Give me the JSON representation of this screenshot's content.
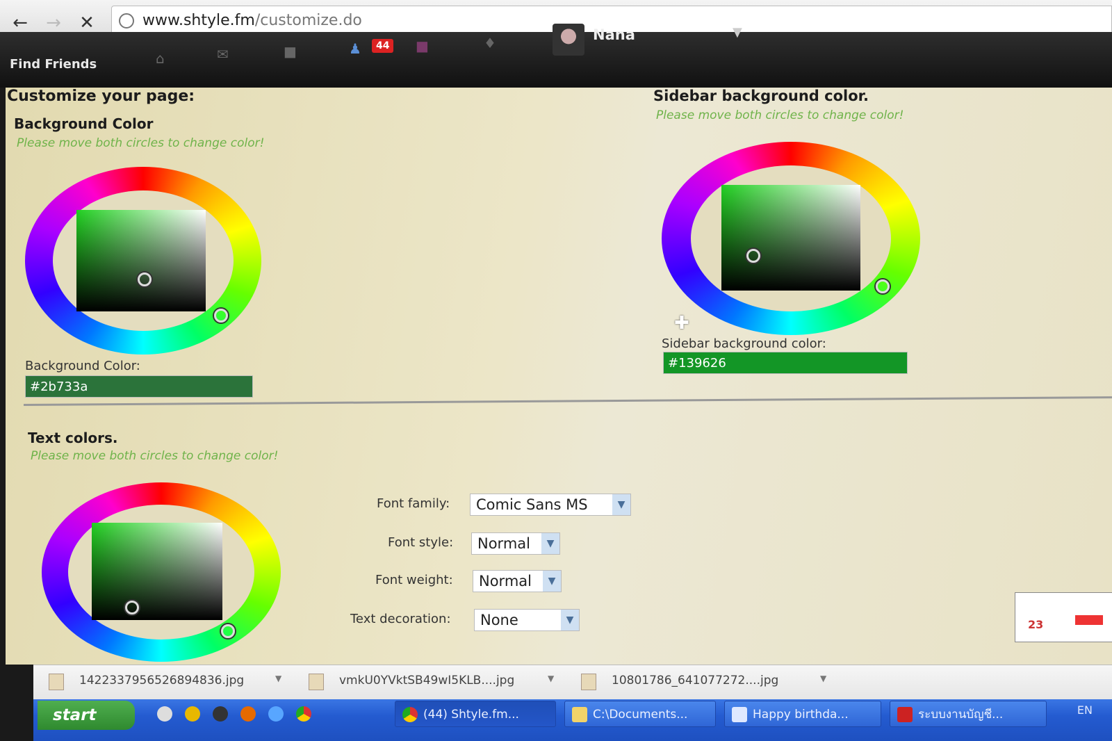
{
  "browser": {
    "url_host": "www.shtyle.fm",
    "url_path": "/customize.do"
  },
  "topbar": {
    "find_friends": "Find Friends",
    "notification_count": "44",
    "user_name": "Nana"
  },
  "page": {
    "title": "Customize your page:",
    "background": {
      "heading": "Background Color",
      "hint": "Please move both circles to change color!",
      "field_label": "Background Color:",
      "value": "#2b733a"
    },
    "sidebar": {
      "heading": "Sidebar background color.",
      "hint": "Please move both circles to change color!",
      "field_label": "Sidebar background color:",
      "value": "#139626"
    },
    "text_colors": {
      "heading": "Text colors.",
      "hint": "Please move both circles to change color!"
    },
    "font": {
      "family_label": "Font family:",
      "family_value": "Comic Sans MS",
      "style_label": "Font style:",
      "style_value": "Normal",
      "weight_label": "Font weight:",
      "weight_value": "Normal",
      "decoration_label": "Text decoration:",
      "decoration_value": "None"
    },
    "mini_widget_number": "23"
  },
  "downloads": [
    {
      "name": "1422337956526894836.jpg"
    },
    {
      "name": "vmkU0YVktSB49wI5KLB....jpg"
    },
    {
      "name": "10801786_641077272....jpg"
    }
  ],
  "taskbar": {
    "start": "start",
    "tasks": [
      {
        "label": "(44) Shtyle.fm..."
      },
      {
        "label": "C:\\Documents..."
      },
      {
        "label": "Happy birthda..."
      },
      {
        "label": "ระบบงานบัญชี..."
      }
    ],
    "lang": "EN"
  },
  "colors": {
    "background_swatch": "#2b733a",
    "sidebar_swatch": "#139626",
    "hint_green": "#6fb34a"
  },
  "icons": [
    "back-arrow-icon",
    "forward-arrow-icon",
    "stop-icon",
    "globe-icon",
    "home-icon",
    "mail-icon",
    "chat-icon",
    "friends-icon",
    "gift-icon",
    "tag-icon",
    "chevron-down-icon",
    "move-cursor-icon",
    "file-icon"
  ]
}
